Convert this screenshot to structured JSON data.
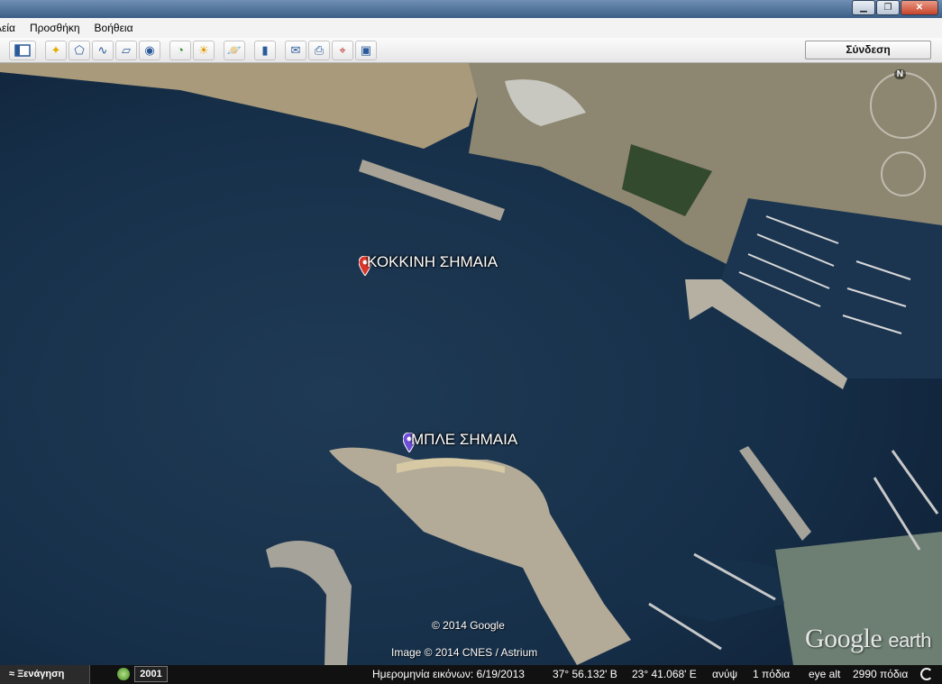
{
  "menu": {
    "items": [
      "λεία",
      "Προσθήκη",
      "Βοήθεια"
    ]
  },
  "toolbar": {
    "signin_label": "Σύνδεση",
    "icons": [
      "sidebar-icon",
      "placemark-icon",
      "polygon-icon",
      "path-icon",
      "overlay-icon",
      "record-tour-icon",
      "historical-imagery-icon",
      "sunlight-icon",
      "planets-icon",
      "ruler-icon",
      "email-icon",
      "print-icon",
      "maps-icon",
      "save-image-icon"
    ]
  },
  "map": {
    "placemarks": [
      {
        "label": "ΚΟΚΚΙΝΗ ΣΗΜΑΙΑ",
        "color": "#d9362b"
      },
      {
        "label": "ΜΠΛΕ ΣΗΜΑΙΑ",
        "color": "#6d4fd8"
      }
    ],
    "copyright_1": "© 2014 Google",
    "copyright_2": "Image © 2014 CNES / Astrium",
    "logo_google": "Google",
    "logo_earth": "earth",
    "compass_n": "N"
  },
  "status": {
    "tour_label": "Ξενάγηση",
    "year": "2001",
    "imagery_date": "Ημερομηνία εικόνων: 6/19/2013",
    "lat": "37° 56.132' Β",
    "lon": "23° 41.068' Ε",
    "elevation": "ανύψ",
    "elevation_value": "1 πόδια",
    "eye_alt_label": "eye alt",
    "eye_alt_value": "2990 πόδια"
  }
}
